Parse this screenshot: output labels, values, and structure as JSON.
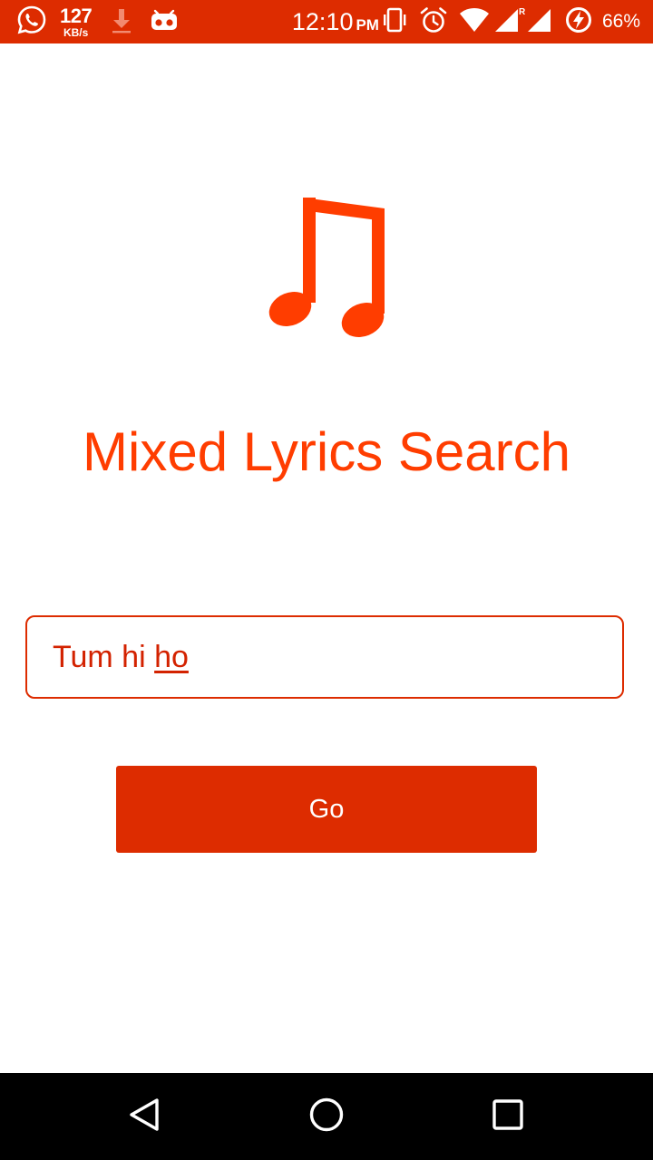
{
  "status_bar": {
    "network_speed_value": "127",
    "network_speed_unit": "KB/s",
    "time": "12:10",
    "time_period": "PM",
    "battery_percent": "66%",
    "left_icons": [
      "whatsapp-icon",
      "download-icon",
      "voicemail-icon"
    ],
    "right_icons": [
      "vibrate-icon",
      "alarm-icon",
      "wifi-icon",
      "signal-roaming-icon",
      "signal-icon",
      "battery-charging-icon"
    ]
  },
  "main": {
    "logo_icon": "music-note-icon",
    "title": "Mixed Lyrics Search",
    "search": {
      "value_prefix": "Tum hi ",
      "value_composing": "ho"
    },
    "go_button_label": "Go"
  },
  "nav_bar": {
    "buttons": [
      "back",
      "home",
      "recents"
    ]
  },
  "colors": {
    "accent": "#dd2c00",
    "title": "#ff3d00",
    "input_text": "#d32200",
    "background": "#ffffff",
    "nav_bar": "#000000"
  }
}
